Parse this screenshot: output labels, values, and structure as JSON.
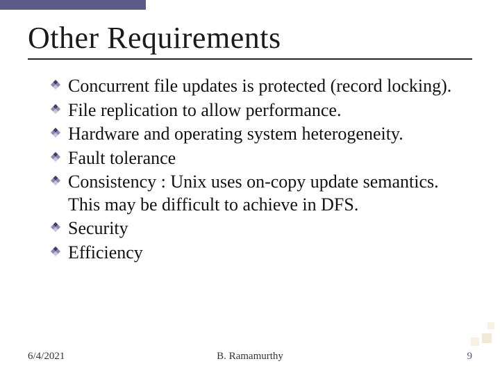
{
  "title": "Other Requirements",
  "bullets": [
    "Concurrent file updates is protected (record locking).",
    "File replication to allow performance.",
    "Hardware and operating system heterogeneity.",
    "Fault tolerance",
    "Consistency : Unix uses on-copy update semantics. This may be difficult to achieve in DFS.",
    "Security",
    "Efficiency"
  ],
  "footer": {
    "date": "6/4/2021",
    "author": "B. Ramamurthy",
    "page": "9"
  },
  "colors": {
    "accent": "#5b5b8a",
    "bullet_dark": "#3d3d66",
    "bullet_light": "#b0b0d0",
    "page_num": "#6b4a8a"
  }
}
